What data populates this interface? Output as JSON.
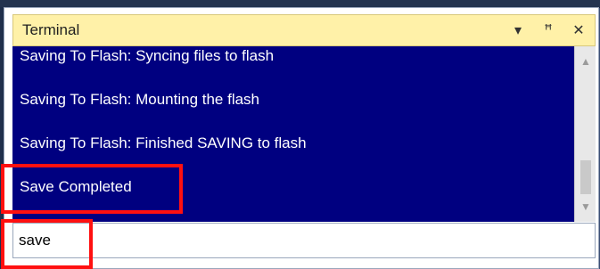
{
  "terminal": {
    "title": "Terminal",
    "controls": {
      "dropdown_icon": "▾",
      "pin_icon": "ꟸ",
      "close_icon": "✕"
    },
    "output_lines": [
      "Saving To Flash: Syncing files to flash",
      "Saving To Flash: Mounting the flash",
      "Saving To Flash: Finished SAVING to flash",
      "Save Completed"
    ],
    "input": {
      "value": "save"
    }
  },
  "colors": {
    "title_bar": "#fff1a8",
    "output_background": "#000080",
    "output_text": "#ffffff",
    "highlight": "#ff1010"
  }
}
